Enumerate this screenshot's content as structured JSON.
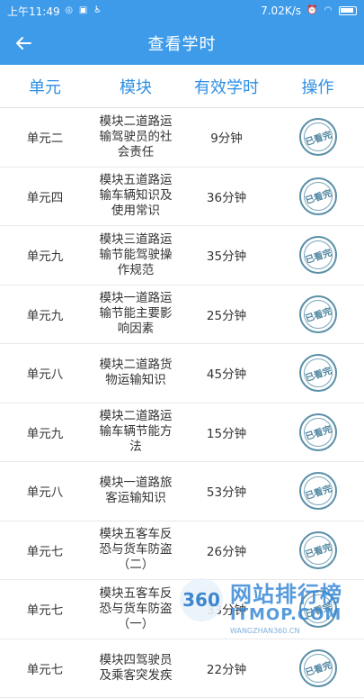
{
  "status_bar": {
    "time": "上午11:49",
    "network_speed": "7.02K/s"
  },
  "header": {
    "title": "查看学时"
  },
  "columns": [
    "单元",
    "模块",
    "有效学时",
    "操作"
  ],
  "rows": [
    {
      "unit": "单元二",
      "module": "模块二道路运输驾驶员的社会责任",
      "hours": "9分钟",
      "action": "已看完"
    },
    {
      "unit": "单元四",
      "module": "模块五道路运输车辆知识及使用常识",
      "hours": "36分钟",
      "action": "已看完"
    },
    {
      "unit": "单元九",
      "module": "模块三道路运输节能驾驶操作规范",
      "hours": "35分钟",
      "action": "已看完"
    },
    {
      "unit": "单元九",
      "module": "模块一道路运输节能主要影响因素",
      "hours": "25分钟",
      "action": "已看完"
    },
    {
      "unit": "单元八",
      "module": "模块二道路货物运输知识",
      "hours": "45分钟",
      "action": "已看完"
    },
    {
      "unit": "单元九",
      "module": "模块二道路运输车辆节能方法",
      "hours": "15分钟",
      "action": "已看完"
    },
    {
      "unit": "单元八",
      "module": "模块一道路旅客运输知识",
      "hours": "53分钟",
      "action": "已看完"
    },
    {
      "unit": "单元七",
      "module": "模块五客车反恐与货车防盗（二）",
      "hours": "26分钟",
      "action": "已看完"
    },
    {
      "unit": "单元七",
      "module": "模块五客车反恐与货车防盗（一）",
      "hours": "33分钟",
      "action": "已看完"
    },
    {
      "unit": "单元七",
      "module": "模块四驾驶员及乘客突发疾",
      "hours": "22分钟",
      "action": "已看完"
    }
  ],
  "watermark": {
    "badge": "360",
    "title": "网站排行榜",
    "brand": "ITMOP.COM",
    "url": "WANGZHAN360.CN"
  }
}
